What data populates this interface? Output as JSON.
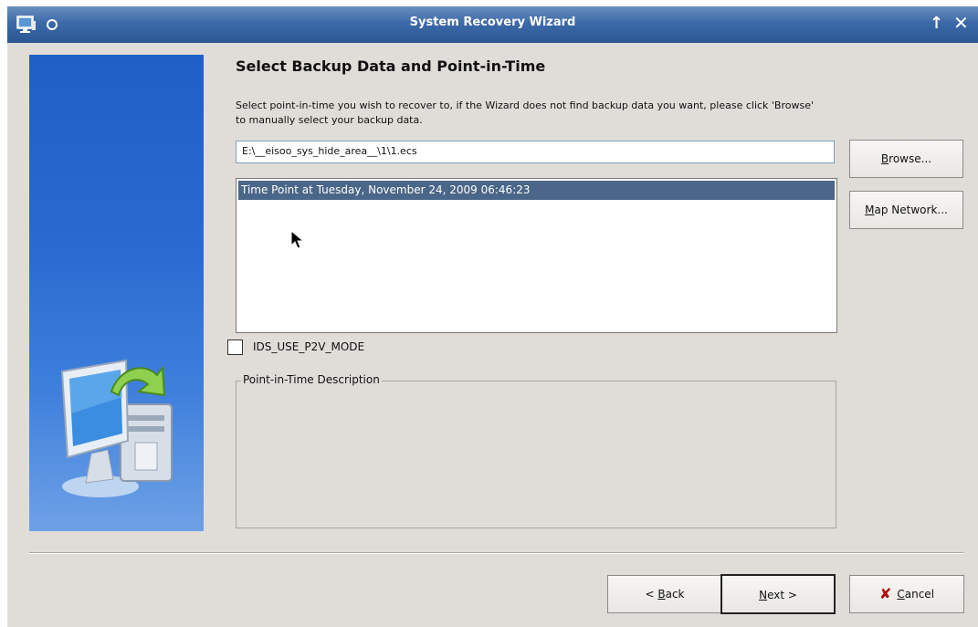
{
  "window": {
    "title": "System Recovery Wizard",
    "maximize_glyph": "↑",
    "close_glyph": "✕"
  },
  "heading": "Select Backup Data and Point-in-Time",
  "instructions": "Select point-in-time you wish to recover to, if the Wizard does not find backup data you want, please click 'Browse' to manually select your backup data.",
  "backup_path": "E:\\__eisoo_sys_hide_area__\\1\\1.ecs",
  "buttons": {
    "browse_mnemonic": "B",
    "browse_rest": "rowse...",
    "map_mnemonic": "M",
    "map_rest": "ap Network...",
    "back_prefix": "< ",
    "back_mnemonic": "B",
    "back_rest": "ack",
    "next_mnemonic": "N",
    "next_rest": "ext >",
    "cancel_mnemonic": "C",
    "cancel_rest": "ancel"
  },
  "time_points": [
    "Time Point at Tuesday, November 24, 2009 06:46:23"
  ],
  "p2v_checkbox": {
    "label": "IDS_USE_P2V_MODE",
    "checked": false
  },
  "description_group": {
    "title": "Point-in-Time Description"
  },
  "icons": {
    "app": "computer-icon",
    "window_menu": "circle-icon",
    "maximize": "arrow-up-icon",
    "close": "close-icon",
    "cancel": "red-x-icon",
    "illustration": "computer-recovery-icon",
    "cursor": "mouse-pointer-icon"
  },
  "colors": {
    "titlebar": "#3c69a8",
    "side_panel": "#2a6ad0",
    "selection": "#4a6688",
    "window_bg": "#e0ddd9"
  }
}
